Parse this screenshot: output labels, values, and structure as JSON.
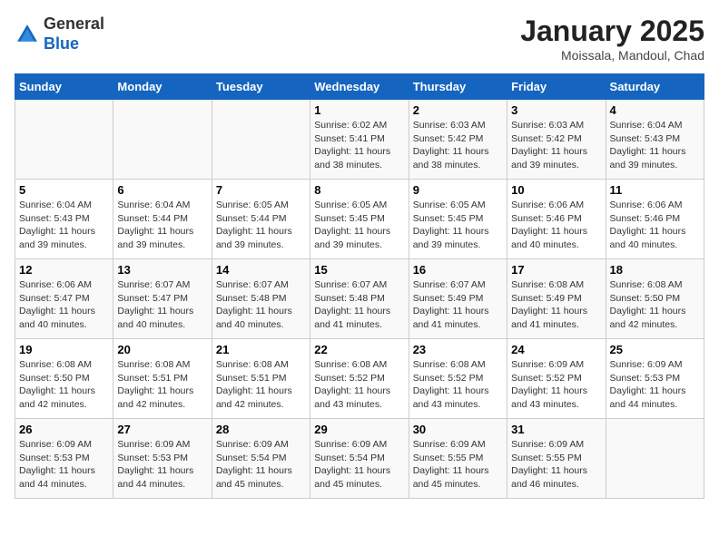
{
  "header": {
    "logo": {
      "general": "General",
      "blue": "Blue"
    },
    "title": "January 2025",
    "location": "Moissala, Mandoul, Chad"
  },
  "days_of_week": [
    "Sunday",
    "Monday",
    "Tuesday",
    "Wednesday",
    "Thursday",
    "Friday",
    "Saturday"
  ],
  "weeks": [
    [
      {
        "day": "",
        "info": ""
      },
      {
        "day": "",
        "info": ""
      },
      {
        "day": "",
        "info": ""
      },
      {
        "day": "1",
        "info": "Sunrise: 6:02 AM\nSunset: 5:41 PM\nDaylight: 11 hours\nand 38 minutes."
      },
      {
        "day": "2",
        "info": "Sunrise: 6:03 AM\nSunset: 5:42 PM\nDaylight: 11 hours\nand 38 minutes."
      },
      {
        "day": "3",
        "info": "Sunrise: 6:03 AM\nSunset: 5:42 PM\nDaylight: 11 hours\nand 39 minutes."
      },
      {
        "day": "4",
        "info": "Sunrise: 6:04 AM\nSunset: 5:43 PM\nDaylight: 11 hours\nand 39 minutes."
      }
    ],
    [
      {
        "day": "5",
        "info": "Sunrise: 6:04 AM\nSunset: 5:43 PM\nDaylight: 11 hours\nand 39 minutes."
      },
      {
        "day": "6",
        "info": "Sunrise: 6:04 AM\nSunset: 5:44 PM\nDaylight: 11 hours\nand 39 minutes."
      },
      {
        "day": "7",
        "info": "Sunrise: 6:05 AM\nSunset: 5:44 PM\nDaylight: 11 hours\nand 39 minutes."
      },
      {
        "day": "8",
        "info": "Sunrise: 6:05 AM\nSunset: 5:45 PM\nDaylight: 11 hours\nand 39 minutes."
      },
      {
        "day": "9",
        "info": "Sunrise: 6:05 AM\nSunset: 5:45 PM\nDaylight: 11 hours\nand 39 minutes."
      },
      {
        "day": "10",
        "info": "Sunrise: 6:06 AM\nSunset: 5:46 PM\nDaylight: 11 hours\nand 40 minutes."
      },
      {
        "day": "11",
        "info": "Sunrise: 6:06 AM\nSunset: 5:46 PM\nDaylight: 11 hours\nand 40 minutes."
      }
    ],
    [
      {
        "day": "12",
        "info": "Sunrise: 6:06 AM\nSunset: 5:47 PM\nDaylight: 11 hours\nand 40 minutes."
      },
      {
        "day": "13",
        "info": "Sunrise: 6:07 AM\nSunset: 5:47 PM\nDaylight: 11 hours\nand 40 minutes."
      },
      {
        "day": "14",
        "info": "Sunrise: 6:07 AM\nSunset: 5:48 PM\nDaylight: 11 hours\nand 40 minutes."
      },
      {
        "day": "15",
        "info": "Sunrise: 6:07 AM\nSunset: 5:48 PM\nDaylight: 11 hours\nand 41 minutes."
      },
      {
        "day": "16",
        "info": "Sunrise: 6:07 AM\nSunset: 5:49 PM\nDaylight: 11 hours\nand 41 minutes."
      },
      {
        "day": "17",
        "info": "Sunrise: 6:08 AM\nSunset: 5:49 PM\nDaylight: 11 hours\nand 41 minutes."
      },
      {
        "day": "18",
        "info": "Sunrise: 6:08 AM\nSunset: 5:50 PM\nDaylight: 11 hours\nand 42 minutes."
      }
    ],
    [
      {
        "day": "19",
        "info": "Sunrise: 6:08 AM\nSunset: 5:50 PM\nDaylight: 11 hours\nand 42 minutes."
      },
      {
        "day": "20",
        "info": "Sunrise: 6:08 AM\nSunset: 5:51 PM\nDaylight: 11 hours\nand 42 minutes."
      },
      {
        "day": "21",
        "info": "Sunrise: 6:08 AM\nSunset: 5:51 PM\nDaylight: 11 hours\nand 42 minutes."
      },
      {
        "day": "22",
        "info": "Sunrise: 6:08 AM\nSunset: 5:52 PM\nDaylight: 11 hours\nand 43 minutes."
      },
      {
        "day": "23",
        "info": "Sunrise: 6:08 AM\nSunset: 5:52 PM\nDaylight: 11 hours\nand 43 minutes."
      },
      {
        "day": "24",
        "info": "Sunrise: 6:09 AM\nSunset: 5:52 PM\nDaylight: 11 hours\nand 43 minutes."
      },
      {
        "day": "25",
        "info": "Sunrise: 6:09 AM\nSunset: 5:53 PM\nDaylight: 11 hours\nand 44 minutes."
      }
    ],
    [
      {
        "day": "26",
        "info": "Sunrise: 6:09 AM\nSunset: 5:53 PM\nDaylight: 11 hours\nand 44 minutes."
      },
      {
        "day": "27",
        "info": "Sunrise: 6:09 AM\nSunset: 5:53 PM\nDaylight: 11 hours\nand 44 minutes."
      },
      {
        "day": "28",
        "info": "Sunrise: 6:09 AM\nSunset: 5:54 PM\nDaylight: 11 hours\nand 45 minutes."
      },
      {
        "day": "29",
        "info": "Sunrise: 6:09 AM\nSunset: 5:54 PM\nDaylight: 11 hours\nand 45 minutes."
      },
      {
        "day": "30",
        "info": "Sunrise: 6:09 AM\nSunset: 5:55 PM\nDaylight: 11 hours\nand 45 minutes."
      },
      {
        "day": "31",
        "info": "Sunrise: 6:09 AM\nSunset: 5:55 PM\nDaylight: 11 hours\nand 46 minutes."
      },
      {
        "day": "",
        "info": ""
      }
    ]
  ]
}
